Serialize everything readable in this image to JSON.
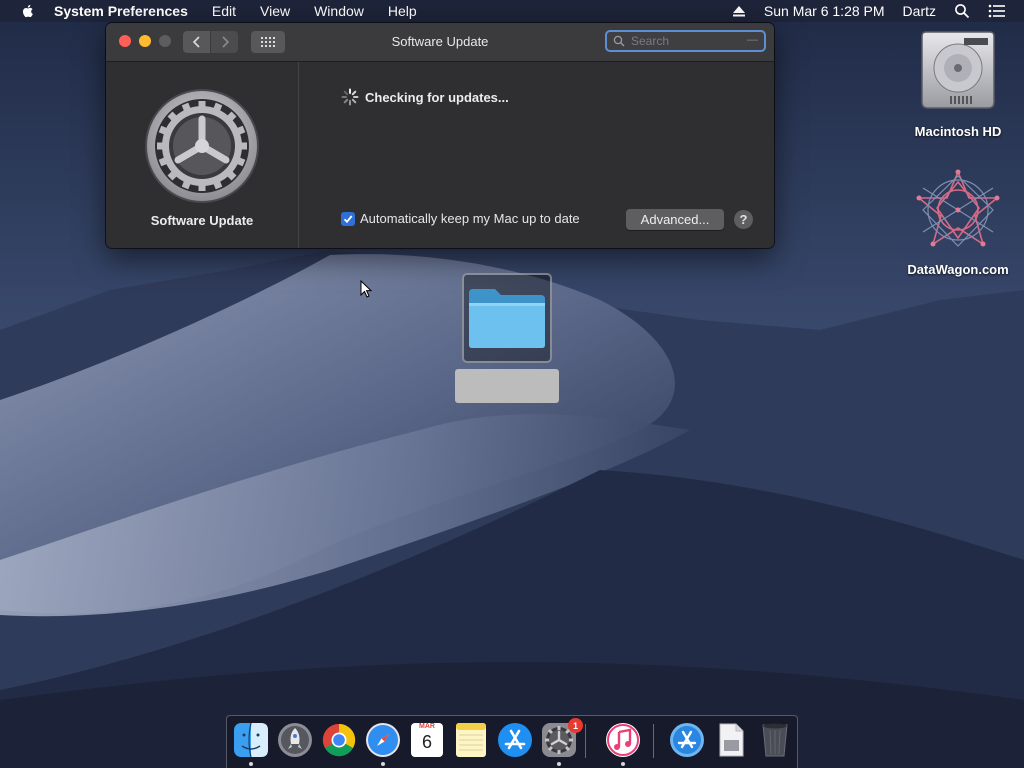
{
  "menubar": {
    "app_name": "System Preferences",
    "menus": [
      "Edit",
      "View",
      "Window",
      "Help"
    ],
    "datetime": "Sun Mar 6  1:28 PM",
    "user": "Dartz"
  },
  "window": {
    "title": "Software Update",
    "search_placeholder": "Search",
    "pane_title": "Software Update",
    "status_text": "Checking for updates...",
    "auto_update_label": "Automatically keep my Mac up to date",
    "auto_update_checked": true,
    "advanced_button": "Advanced...",
    "help_button": "?"
  },
  "desktop": {
    "icons": [
      {
        "label": "Macintosh HD",
        "icon": "hard-drive-icon"
      },
      {
        "label": "DataWagon.com",
        "icon": "datawagon-icon"
      },
      {
        "label": "",
        "icon": "folder-icon",
        "selected": true
      }
    ]
  },
  "dock": {
    "items": [
      {
        "name": "Finder",
        "icon": "finder-icon",
        "running": true
      },
      {
        "name": "Launchpad",
        "icon": "launchpad-icon",
        "running": false
      },
      {
        "name": "Chrome",
        "icon": "chrome-icon",
        "running": false
      },
      {
        "name": "Safari",
        "icon": "safari-icon",
        "running": true
      },
      {
        "name": "Calendar",
        "icon": "calendar-icon",
        "running": false,
        "month": "MAR",
        "day": "6"
      },
      {
        "name": "Notes",
        "icon": "notes-icon",
        "running": false
      },
      {
        "name": "App Store",
        "icon": "app-store-icon",
        "running": false
      },
      {
        "name": "System Preferences",
        "icon": "system-preferences-icon",
        "running": true,
        "badge": "1"
      },
      {
        "name": "iTunes",
        "icon": "itunes-icon",
        "running": true
      },
      {
        "name": "Applications",
        "icon": "applications-folder-icon",
        "running": false
      },
      {
        "name": "Document",
        "icon": "document-icon",
        "running": false
      },
      {
        "name": "Trash",
        "icon": "trash-icon",
        "running": false
      }
    ]
  },
  "colors": {
    "accent": "#2e6fd8",
    "close": "#ff5f57",
    "minimize": "#febc2e",
    "badge": "#e83a30"
  }
}
